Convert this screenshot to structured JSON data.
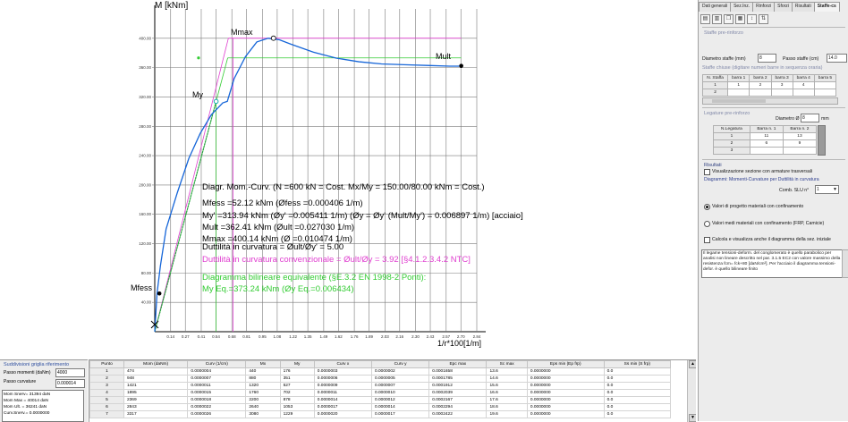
{
  "chart_data": {
    "type": "line",
    "ylabel": "M [kNm]",
    "xlabel": "1/r*100[1/m]",
    "yticks": [
      "40.00",
      "80.00",
      "120.00",
      "160.00",
      "200.00",
      "240.00",
      "280.00",
      "320.00",
      "360.00",
      "400.00"
    ],
    "xticks": [
      "0.14",
      "0.27",
      "0.41",
      "0.54",
      "0.68",
      "0.81",
      "0.95",
      "1.08",
      "1.22",
      "1.35",
      "1.49",
      "1.62",
      "1.76",
      "1.89",
      "2.03",
      "2.16",
      "2.30",
      "2.43",
      "2.57",
      "2.70",
      "2.84"
    ],
    "xlim": [
      0,
      2.84
    ],
    "ylim": [
      0,
      440
    ],
    "series": [
      {
        "values_x": [
          0.0,
          0.02,
          0.05,
          0.1,
          0.2,
          0.3,
          0.4,
          0.5,
          0.6,
          0.64,
          0.7,
          0.8,
          0.9,
          1.0,
          1.1,
          1.2,
          1.4,
          1.6,
          1.8,
          2.0,
          2.2,
          2.4,
          2.6,
          2.7
        ],
        "values_y": [
          0,
          52,
          90,
          140,
          190,
          236,
          270,
          296,
          312,
          314,
          345,
          375,
          395,
          400,
          398,
          392,
          381,
          373,
          368,
          365,
          364,
          363,
          362,
          362
        ]
      }
    ],
    "points": {
      "mfess": {
        "label": "Mfess",
        "x": 0.0406,
        "y": 52.12
      },
      "my": {
        "label": "My",
        "x": 0.5411,
        "y": 313.94
      },
      "mmax": {
        "label": "Mmax",
        "x": 1.0474,
        "y": 400.14
      },
      "mult": {
        "label": "Mult",
        "x": 2.703,
        "y": 362.41
      }
    },
    "bilinear": {
      "eq_x": 0.6434,
      "my_eq": 373.24,
      "mult_x": 2.703
    }
  },
  "annotations": {
    "title": "Diagr. Mom.-Curv. (N =600 kN = Cost. Mx/My = 150.00/80.00 kNm = Cost.)",
    "mfess": "Mfess =52.12 kNm  (Øfess =0.000406 1/m)",
    "my": "My' =313.94 kNm  (Øy' =0.005411 1/m)  (Øy = Øy' (Mult/My') = 0.006897 1/m) [acciaio]",
    "mult": "Mult =362.41 kNm  (Øult =0.027030 1/m)",
    "mmax": "Mmax =400.14 kNm  (Ø =0.010474 1/m)",
    "duttilita": "Duttilità in curvatura = Øult/Øy' = 5.00",
    "duttilita_conv": "Duttilità in curvatura convenzionale = Øult/Øy = 3.92  [§4.1.2.3.4.2 NTC]",
    "bilineare": "Diagramma bilineare equivalente (§E.3.2 EN 1998-2 Ponti):",
    "my_eq": "My Eq.=373.24 kNm  (Øy Eq.=0.006434)"
  },
  "colors": {
    "curve": "#1565d8",
    "elastic": "#2e9d4a",
    "pink": "#e040d0",
    "green": "#33cc33",
    "grid": "#7a7a7a"
  },
  "tabs": [
    "Dati generali",
    "Sez.Inz.",
    "Rinforzi",
    "Sforzi",
    "Risultati",
    "Staffe-cs"
  ],
  "toolbar_icons": [
    "open-icon",
    "save-icon",
    "copy-icon",
    "table-icon",
    "sort-icon",
    "swap-icon"
  ],
  "staffe": {
    "group_title": "Staffe pre-rinforzo",
    "diametro_label": "Diametro staffe (mm)",
    "diametro_value": "8",
    "passo_label": "Passo staffe (cm)",
    "passo_value": "14.0",
    "chiuse_title": "Staffe chiuse (digitare numeri barre in sequenza oraria)",
    "chiuse_headers": [
      "N. Staffa",
      "barra 1",
      "barra 2",
      "barra 3",
      "barra 4",
      "barra 5"
    ],
    "chiuse_rows": [
      [
        "1",
        "1",
        "2",
        "3",
        "4",
        ""
      ],
      [
        "2",
        "",
        "",
        "",
        "",
        ""
      ]
    ],
    "legature_title": "Legature pre-rinforzo",
    "legature_diam_label": "Diametro Ø",
    "legature_diam_value": "8",
    "legature_unit": "mm",
    "legature_headers": [
      "N.Legatura",
      "Barra n. 1",
      "Barra n. 2"
    ],
    "legature_rows": [
      [
        "1",
        "11",
        "13"
      ],
      [
        "2",
        "6",
        "9"
      ],
      [
        "3",
        "",
        ""
      ]
    ]
  },
  "risultati": {
    "title": "Risultati",
    "visualizza_label": "Visualizzazione sezione con armature trasversali",
    "diagrammi_label": "Diagrammi: Momenti-Curvature per Duttilità in curvatura",
    "comb_label": "Comb. SLU n°",
    "comb_value": "1",
    "radio1_label": "Valori di progetto materiali con confinamento",
    "radio2_label": "Valori medi materiali con confinamento  (FRP,  Camicie)",
    "check_label": "Calcola e visualizza anche il diagramma della sez. iniziale",
    "note_text": "Il legame tensioni-deform. del conglomerato è quello parabolico per analisi non lineare descritto nel par. 3.1.5 EC2 con valore massimo della resistenza fcm= fck+80 [daN/cm²]. Per l'acciaio il diagramma tensioni-defor. è quello bilineare finito"
  },
  "griglia": {
    "title": "Suddivisioni griglia riferimento",
    "passo_momenti_label": "Passo momenti (daNm)",
    "passo_momenti_value": "4000",
    "passo_curvature_label": "Passo  curvature",
    "passo_curvature_value": "0.000014",
    "summary": [
      "Mom Snerv= 31394 daN",
      "Mom Max    =  40014 daN",
      "Mom Ult.    =  36241 daN",
      "Curv.Snerv.= 0.0000000"
    ]
  },
  "bottom_table": {
    "headers": [
      "Punto",
      "Mom (daNm)",
      "Curv (1/cm)",
      "Mx",
      "My",
      "Curv x",
      "Curv y",
      "Epc max",
      "Sc max",
      "Eps min  (Ep frp)",
      "Ss min  (S frp)"
    ],
    "rows": [
      [
        "1",
        "474",
        "0.0000004",
        "440",
        "176",
        "0.0000003",
        "0.0000002",
        "0.0001658",
        "13.6",
        "0.0000000",
        "0.0"
      ],
      [
        "2",
        "948",
        "0.0000007",
        "880",
        "351",
        "0.0000006",
        "0.0000005",
        "0.0001785",
        "14.6",
        "0.0000000",
        "0.0"
      ],
      [
        "3",
        "1421",
        "0.0000011",
        "1320",
        "527",
        "0.0000009",
        "0.0000007",
        "0.0001912",
        "15.6",
        "0.0000000",
        "0.0"
      ],
      [
        "4",
        "1895",
        "0.0000015",
        "1760",
        "702",
        "0.0000011",
        "0.0000010",
        "0.0002039",
        "16.6",
        "0.0000000",
        "0.0"
      ],
      [
        "5",
        "2369",
        "0.0000018",
        "2200",
        "878",
        "0.0000014",
        "0.0000012",
        "0.0002167",
        "17.6",
        "0.0000000",
        "0.0"
      ],
      [
        "6",
        "2843",
        "0.0000022",
        "2640",
        "1053",
        "0.0000017",
        "0.0000014",
        "0.0002294",
        "18.6",
        "0.0000000",
        "0.0"
      ],
      [
        "7",
        "3317",
        "0.0000026",
        "3080",
        "1229",
        "0.0000020",
        "0.0000017",
        "0.0002422",
        "19.6",
        "0.0000000",
        "0.0"
      ]
    ]
  }
}
